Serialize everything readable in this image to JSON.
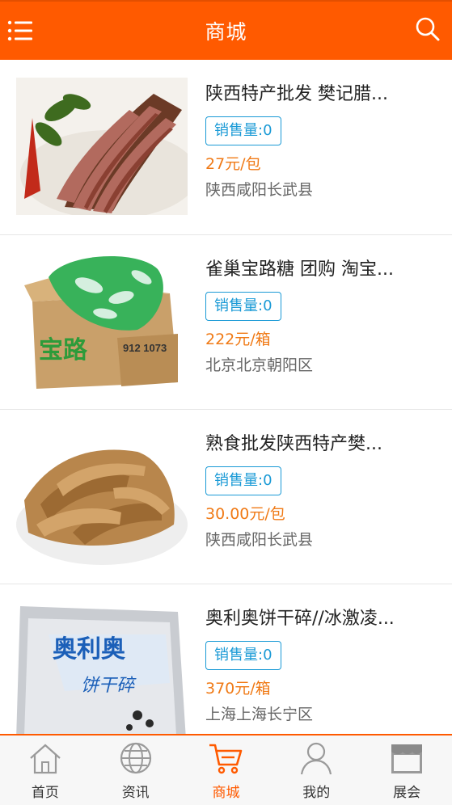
{
  "header": {
    "title": "商城",
    "menu_icon": "menu-icon",
    "search_icon": "search-icon"
  },
  "colors": {
    "brand": "#ff5a00",
    "badge": "#1a9ad6",
    "price": "#f07a16"
  },
  "products": [
    {
      "name": "陕西特产批发 樊记腊...",
      "sales": "销售量:0",
      "price": "27元/包",
      "location": "陕西咸阳长武县"
    },
    {
      "name": "雀巢宝路糖 团购 淘宝...",
      "sales": "销售量:0",
      "price": "222元/箱",
      "location": "北京北京朝阳区"
    },
    {
      "name": "熟食批发陕西特产樊...",
      "sales": "销售量:0",
      "price": "30.00元/包",
      "location": "陕西咸阳长武县"
    },
    {
      "name": "奥利奥饼干碎//冰激凌...",
      "sales": "销售量:0",
      "price": "370元/箱",
      "location": "上海上海长宁区"
    }
  ],
  "product_images": {
    "box_code": "912 1073",
    "box_brand": "宝路",
    "bag_brand": "奥利奥",
    "bag_sub": "饼干碎"
  },
  "tabs": [
    {
      "label": "首页",
      "icon": "home-icon",
      "active": false
    },
    {
      "label": "资讯",
      "icon": "globe-icon",
      "active": false
    },
    {
      "label": "商城",
      "icon": "cart-icon",
      "active": true
    },
    {
      "label": "我的",
      "icon": "user-icon",
      "active": false
    },
    {
      "label": "展会",
      "icon": "store-icon",
      "active": false
    }
  ]
}
